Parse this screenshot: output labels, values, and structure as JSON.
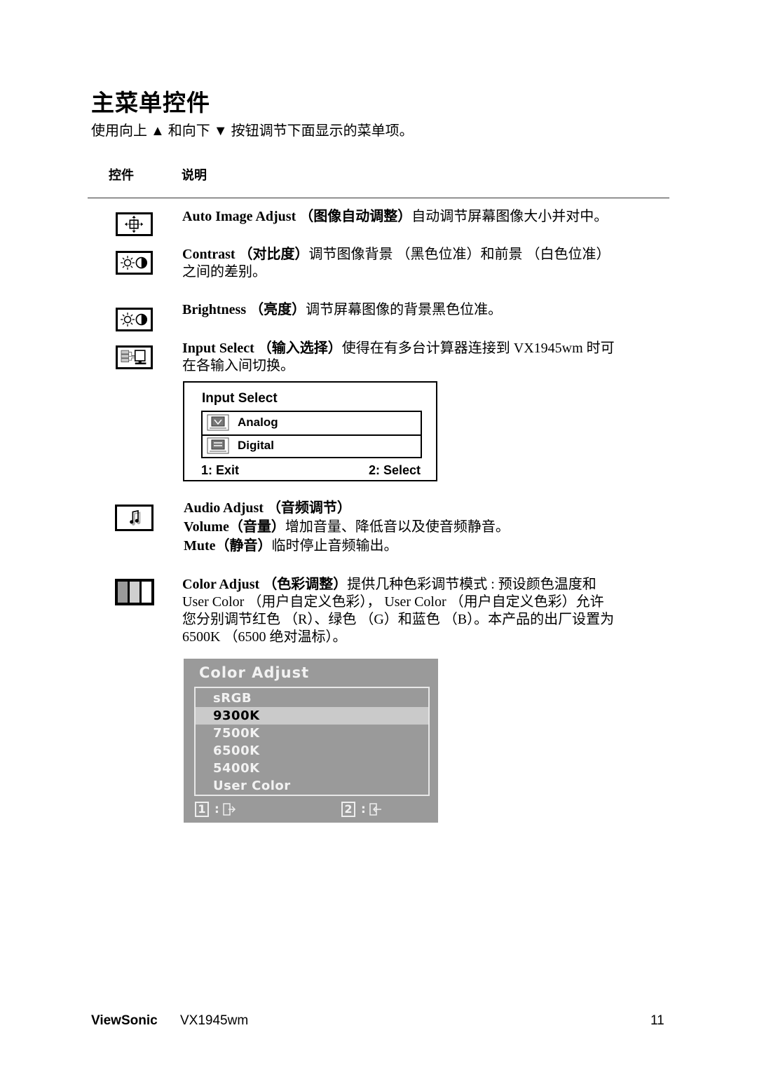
{
  "page": {
    "title": "主菜单控件",
    "subtitle": "使用向上 ▲ 和向下 ▼ 按钮调节下面显示的菜单项。",
    "columns": {
      "control": "控件",
      "description": "说明"
    }
  },
  "items": [
    {
      "icon": "auto-image-adjust-icon",
      "name": "Auto Image Adjust",
      "name_cn": "（图像自动调整）",
      "text": "自动调节屏幕图像大小并对中。"
    },
    {
      "icon": "contrast-icon",
      "name": "Contrast",
      "name_cn": "（对比度）",
      "text": "调节图像背景 （黑色位准）和前景 （白色位准）",
      "text2": "之间的差别。"
    },
    {
      "icon": "brightness-icon",
      "name": "Brightness",
      "name_cn": "（亮度）",
      "text": "调节屏幕图像的背景黑色位准。"
    },
    {
      "icon": "input-select-icon",
      "name": "Input Select",
      "name_cn": "（输入选择）",
      "text": "使得在有多台计算器连接到 VX1945wm 时可",
      "text2": "在各输入间切换。"
    },
    {
      "icon": "audio-adjust-icon",
      "name": "Audio Adjust",
      "name_cn": "（音频调节）",
      "sub": [
        {
          "name": "Volume",
          "name_cn": "（音量）",
          "text": "增加音量、降低音以及使音频静音。"
        },
        {
          "name": "Mute",
          "name_cn": "（静音）",
          "text": "临时停止音频输出。"
        }
      ]
    },
    {
      "icon": "color-adjust-icon",
      "name": "Color Adjust",
      "name_cn": "（色彩调整）",
      "text": "提供几种色彩调节模式 : 预设颜色温度和",
      "text2": "User Color （用户自定义色彩）， User Color （用户自定义色彩）允许",
      "text3": "您分别调节红色 （R）、绿色 （G）和蓝色 （B）。本产品的出厂设置为",
      "text4": "6500K （6500 绝对温标）。"
    }
  ],
  "input_select_osd": {
    "title": "Input Select",
    "options": [
      {
        "label": "Analog",
        "icon": "analog-monitor-icon"
      },
      {
        "label": "Digital",
        "icon": "digital-monitor-icon"
      }
    ],
    "footer_left": "1: Exit",
    "footer_right": "2: Select"
  },
  "color_adjust_osd": {
    "title": "Color Adjust",
    "options": [
      "sRGB",
      "9300K",
      "7500K",
      "6500K",
      "5400K",
      "User Color"
    ],
    "selected": "9300K",
    "footer": [
      {
        "key": "1",
        "icon": "exit-door-icon"
      },
      {
        "key": "2",
        "icon": "enter-door-icon"
      }
    ]
  },
  "footer": {
    "brand": "ViewSonic",
    "model": "VX1945wm",
    "page_number": "11"
  }
}
